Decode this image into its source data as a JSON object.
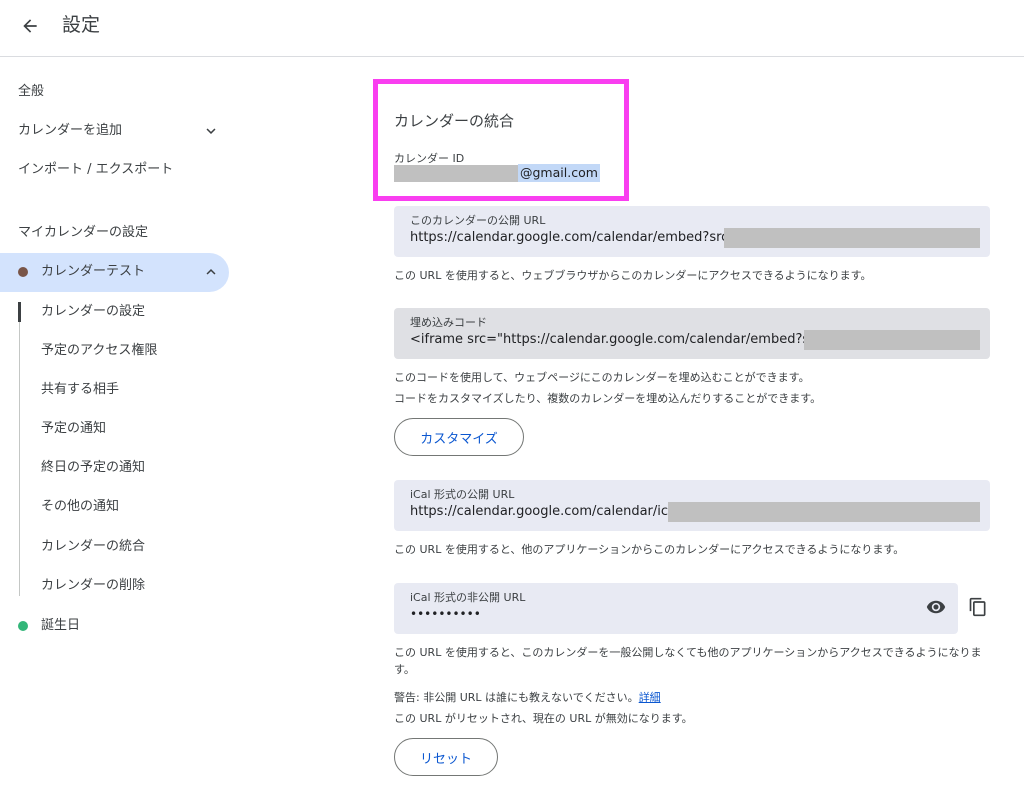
{
  "header": {
    "title": "設定"
  },
  "sidebar": {
    "general": "全般",
    "add_calendar": "カレンダーを追加",
    "import_export": "インポート / エクスポート",
    "my_calendars_header": "マイカレンダーの設定",
    "calendar_test": {
      "name": "カレンダーテスト",
      "color": "#795548"
    },
    "sub_items": [
      "カレンダーの設定",
      "予定のアクセス権限",
      "共有する相手",
      "予定の通知",
      "終日の予定の通知",
      "その他の通知",
      "カレンダーの統合",
      "カレンダーの削除"
    ],
    "birthdays": {
      "name": "誕生日",
      "color": "#33b679"
    }
  },
  "main": {
    "section_title": "カレンダーの統合",
    "calendar_id_label": "カレンダー ID",
    "calendar_id_suffix": "@gmail.com",
    "public_url": {
      "label": "このカレンダーの公開 URL",
      "value": "https://calendar.google.com/calendar/embed?src=c",
      "help": "この URL を使用すると、ウェブブラウザからこのカレンダーにアクセスできるようになります。"
    },
    "embed_code": {
      "label": "埋め込みコード",
      "value": "<iframe src=\"https://calendar.google.com/calendar/embed?src=",
      "help_line1": "このコードを使用して、ウェブページにこのカレンダーを埋め込むことができます。",
      "help_line2": "コードをカスタマイズしたり、複数のカレンダーを埋め込んだりすることができます。",
      "customize_button": "カスタマイズ"
    },
    "ical_public": {
      "label": "iCal 形式の公開 URL",
      "value": "https://calendar.google.com/calendar/ical/",
      "help": "この URL を使用すると、他のアプリケーションからこのカレンダーにアクセスできるようになります。"
    },
    "ical_private": {
      "label": "iCal 形式の非公開 URL",
      "value": "••••••••••",
      "help": "この URL を使用すると、このカレンダーを一般公開しなくても他のアプリケーションからアクセスできるようになります。",
      "warning_text": "警告: 非公開 URL は誰にも教えないでください。",
      "warning_link": "詳細",
      "reset_note": "この URL がリセットされ、現在の URL が無効になります。",
      "reset_button": "リセット"
    }
  }
}
